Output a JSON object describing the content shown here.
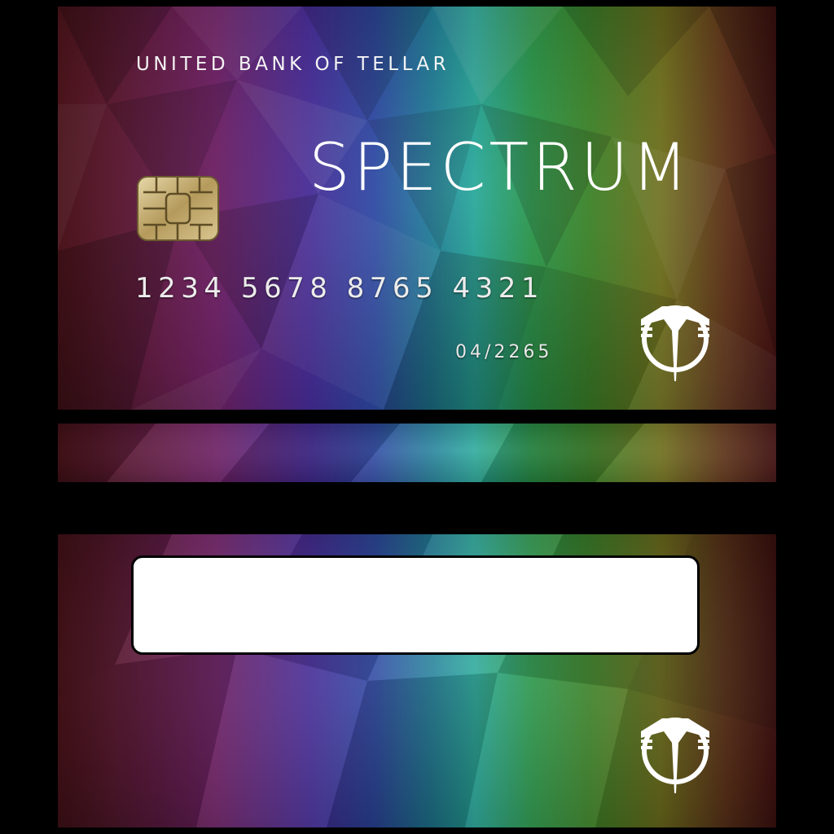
{
  "card_front": {
    "bank_name": "UNITED BANK OF TELLAR",
    "product_name": "SPECTRUM",
    "card_number": "1234 5678 8765 4321",
    "expiry": "04/2265",
    "chip_icon": "emv-chip-icon",
    "logo_icon": "tellar-t-emblem-icon"
  },
  "card_back": {
    "signature_panel_text": "",
    "logo_icon": "tellar-t-emblem-icon"
  },
  "colors": {
    "background": "#000000",
    "text": "#ffffff",
    "chip_gold": "#c9b27a",
    "spectrum_start": "#5a1820",
    "spectrum_blue": "#2e4aa8",
    "spectrum_teal": "#25a89a",
    "spectrum_green": "#2a9a4a",
    "spectrum_end": "#4a1414"
  }
}
